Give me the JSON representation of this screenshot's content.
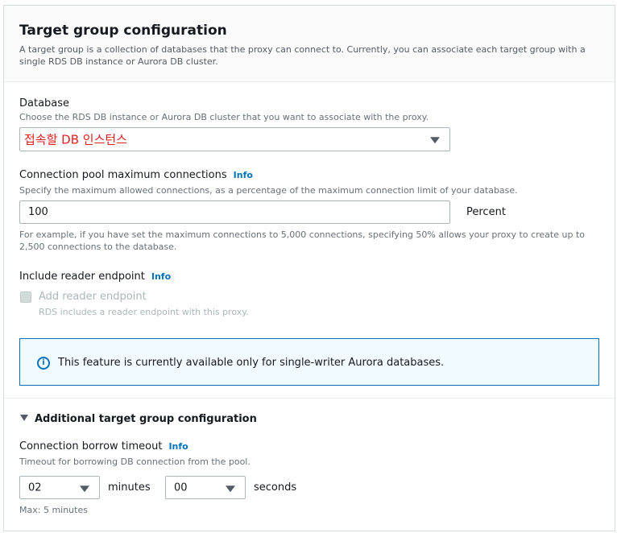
{
  "panel": {
    "title": "Target group configuration",
    "description": "A target group is a collection of databases that the proxy can connect to. Currently, you can associate each target group with a single RDS DB instance or Aurora DB cluster."
  },
  "database": {
    "label": "Database",
    "description": "Choose the RDS DB instance or Aurora DB cluster that you want to associate with the proxy.",
    "selected": "접속할 DB 인스턴스",
    "selected_color": "#e02020"
  },
  "pool": {
    "label": "Connection pool maximum connections",
    "info": "Info",
    "description": "Specify the maximum allowed connections, as a percentage of the maximum connection limit of your database.",
    "value": "100",
    "unit": "Percent",
    "example": "For example, if you have set the maximum connections to 5,000 connections, specifying 50% allows your proxy to create up to 2,500 connections to the database."
  },
  "reader": {
    "label": "Include reader endpoint",
    "info": "Info",
    "checkbox_label": "Add reader endpoint",
    "checkbox_description": "RDS includes a reader endpoint with this proxy.",
    "checked": false
  },
  "alert": {
    "icon": "info-icon",
    "text": "This feature is currently available only for single-writer Aurora databases."
  },
  "additional": {
    "title": "Additional target group configuration",
    "expanded": true
  },
  "borrow_timeout": {
    "label": "Connection borrow timeout",
    "info": "Info",
    "description": "Timeout for borrowing DB connection from the pool.",
    "minutes_value": "02",
    "minutes_label": "minutes",
    "seconds_value": "00",
    "seconds_label": "seconds",
    "constraint": "Max: 5 minutes"
  },
  "colors": {
    "link": "#0073bb",
    "alert_border": "#0073bb",
    "alert_bg": "#f1faff"
  }
}
